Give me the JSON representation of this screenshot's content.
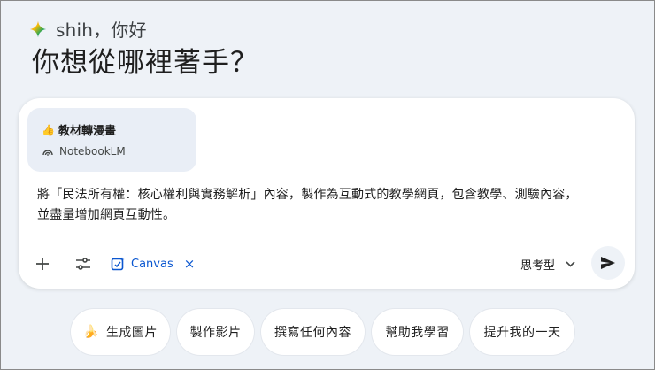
{
  "greeting": {
    "text": "shih，你好",
    "icon": "gemini-spark-icon"
  },
  "headline": "你想從哪裡著手？",
  "attachment": {
    "emoji": "👍",
    "title": "教材轉漫畫",
    "source_icon": "notebooklm-icon",
    "source": "NotebookLM"
  },
  "prompt": {
    "line1": "將「民法所有權：核心權利與實務解析」內容，製作為互動式的教學網頁，包含教學、測驗內容，",
    "line2": "並盡量增加網頁互動性。"
  },
  "toolbar": {
    "add_icon": "plus-icon",
    "tools_icon": "tools-icon",
    "canvas_label": "Canvas",
    "canvas_icon": "canvas-icon",
    "canvas_remove": "×",
    "mode_label": "思考型",
    "send_icon": "send-icon"
  },
  "suggestions": [
    {
      "emoji": "🍌",
      "label": "生成圖片"
    },
    {
      "label": "製作影片"
    },
    {
      "label": "撰寫任何內容"
    },
    {
      "label": "幫助我學習"
    },
    {
      "label": "提升我的一天"
    }
  ],
  "colors": {
    "background": "#eef2f7",
    "accent": "#0b57d0",
    "attachment_bg": "#e9eef6"
  }
}
